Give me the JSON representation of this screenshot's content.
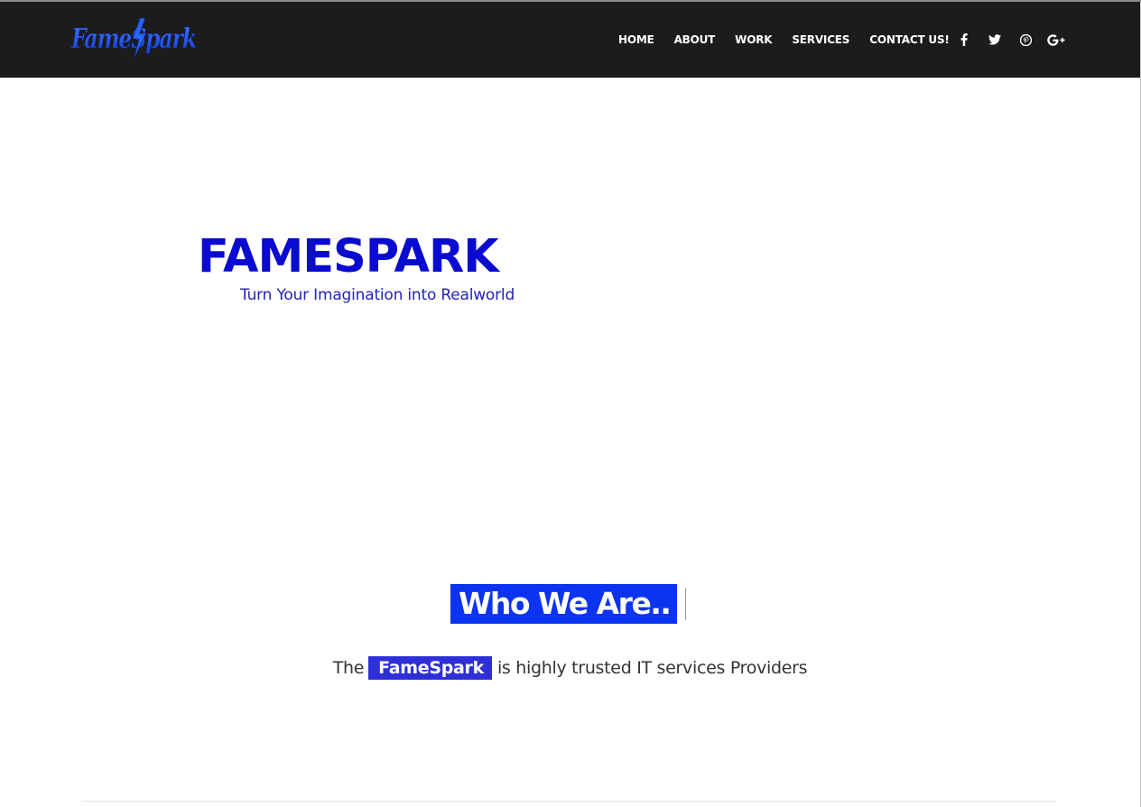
{
  "brand": {
    "logo_text": "FameSpark",
    "logo_color": "#1a4fe0",
    "accent_color": "#0a0ad0"
  },
  "nav": {
    "items": [
      {
        "label": "HOME"
      },
      {
        "label": "ABOUT"
      },
      {
        "label": "WORK"
      },
      {
        "label": "SERVICES"
      },
      {
        "label": "CONTACT US!"
      }
    ],
    "social": [
      {
        "icon": "facebook-icon"
      },
      {
        "icon": "twitter-icon"
      },
      {
        "icon": "pinterest-icon"
      },
      {
        "icon": "google-plus-icon"
      }
    ]
  },
  "hero": {
    "title": "FAMESPARK",
    "tagline": "Turn Your Imagination into Realworld"
  },
  "about": {
    "heading": "Who We Are..",
    "intro_prefix": "The",
    "intro_brand": "FameSpark",
    "intro_suffix": "is highly trusted IT services Providers"
  },
  "colors": {
    "navbar_bg": "#1c1c1c",
    "heading_highlight": "#0b33f0",
    "brand_highlight": "#2f2fd8",
    "tagline": "#2323b8"
  }
}
